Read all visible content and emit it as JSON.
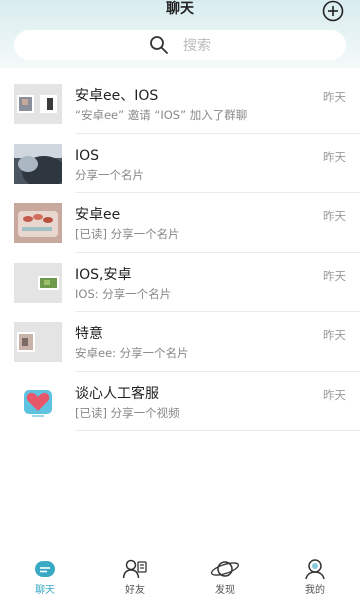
{
  "header": {
    "title": "聊天"
  },
  "search": {
    "placeholder": "搜索"
  },
  "chats": [
    {
      "name": "安卓ee、IOS",
      "message": "“安卓ee” 邀请 “IOS” 加入了群聊",
      "time": "昨天",
      "avatar": "group-avatar"
    },
    {
      "name": "IOS",
      "message": "分享一个名片",
      "time": "昨天",
      "avatar": "photo-avatar"
    },
    {
      "name": "安卓ee",
      "message": "[已读] 分享一个名片",
      "time": "昨天",
      "avatar": "photo-avatar"
    },
    {
      "name": "IOS,安卓",
      "message": "IOS: 分享一个名片",
      "time": "昨天",
      "avatar": "group-avatar"
    },
    {
      "name": "特意",
      "message": "安卓ee: 分享一个名片",
      "time": "昨天",
      "avatar": "group-avatar"
    },
    {
      "name": "谈心人工客服",
      "message": "[已读] 分享一个视频",
      "time": "昨天",
      "avatar": "heart-avatar"
    }
  ],
  "tabs": [
    {
      "label": "聊天",
      "icon": "chat-bubble-icon",
      "active": true
    },
    {
      "label": "好友",
      "icon": "friends-icon",
      "active": false
    },
    {
      "label": "发现",
      "icon": "planet-icon",
      "active": false
    },
    {
      "label": "我的",
      "icon": "profile-icon",
      "active": false
    }
  ],
  "colors": {
    "accent": "#3aa9c4",
    "header_bg": "#dcedf0"
  }
}
